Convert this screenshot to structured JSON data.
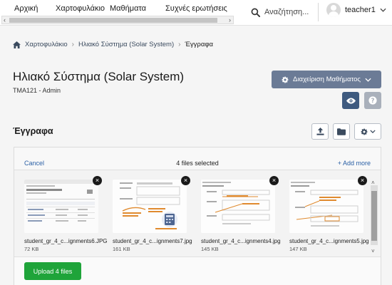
{
  "nav": {
    "links": [
      "Αρχική",
      "Χαρτοφυλάκιο",
      "Μαθήματα",
      "Συχνές ερωτήσεις"
    ],
    "search_label": "Αναζήτηση...",
    "user_name": "teacher1"
  },
  "breadcrumb": {
    "items": [
      "Χαρτοφυλάκιο",
      "Ηλιακό Σύστημα (Solar System)",
      "Έγγραφα"
    ]
  },
  "header": {
    "title": "Ηλιακό Σύστημα (Solar System)",
    "subtitle": "TMA121 - Admin",
    "manage_label": "Διαχείριση Μαθήματος"
  },
  "section": {
    "title": "Έγγραφα"
  },
  "uploader": {
    "cancel_label": "Cancel",
    "status": "4 files selected",
    "add_more_label": "+ Add more",
    "upload_label": "Upload 4 files",
    "files": [
      {
        "name": "student_gr_4_c...ignments6.JPG",
        "size": "72 KB"
      },
      {
        "name": "student_gr_4_c...ignments7.jpg",
        "size": "161 KB"
      },
      {
        "name": "student_gr_4_c...ignments4.jpg",
        "size": "145 KB"
      },
      {
        "name": "student_gr_4_c...ignments5.jpg",
        "size": "147 KB"
      }
    ]
  },
  "colors": {
    "manage_button": "#6b7b96",
    "eye_button": "#3e5a7f",
    "help_button": "#a9b0bb",
    "upload_button": "#1fa43a",
    "link": "#2a5fa5"
  },
  "icons": [
    "search-icon",
    "home-icon",
    "gear-icon",
    "chevron-down-icon",
    "eye-icon",
    "help-icon",
    "upload-icon",
    "folder-icon",
    "close-icon"
  ]
}
